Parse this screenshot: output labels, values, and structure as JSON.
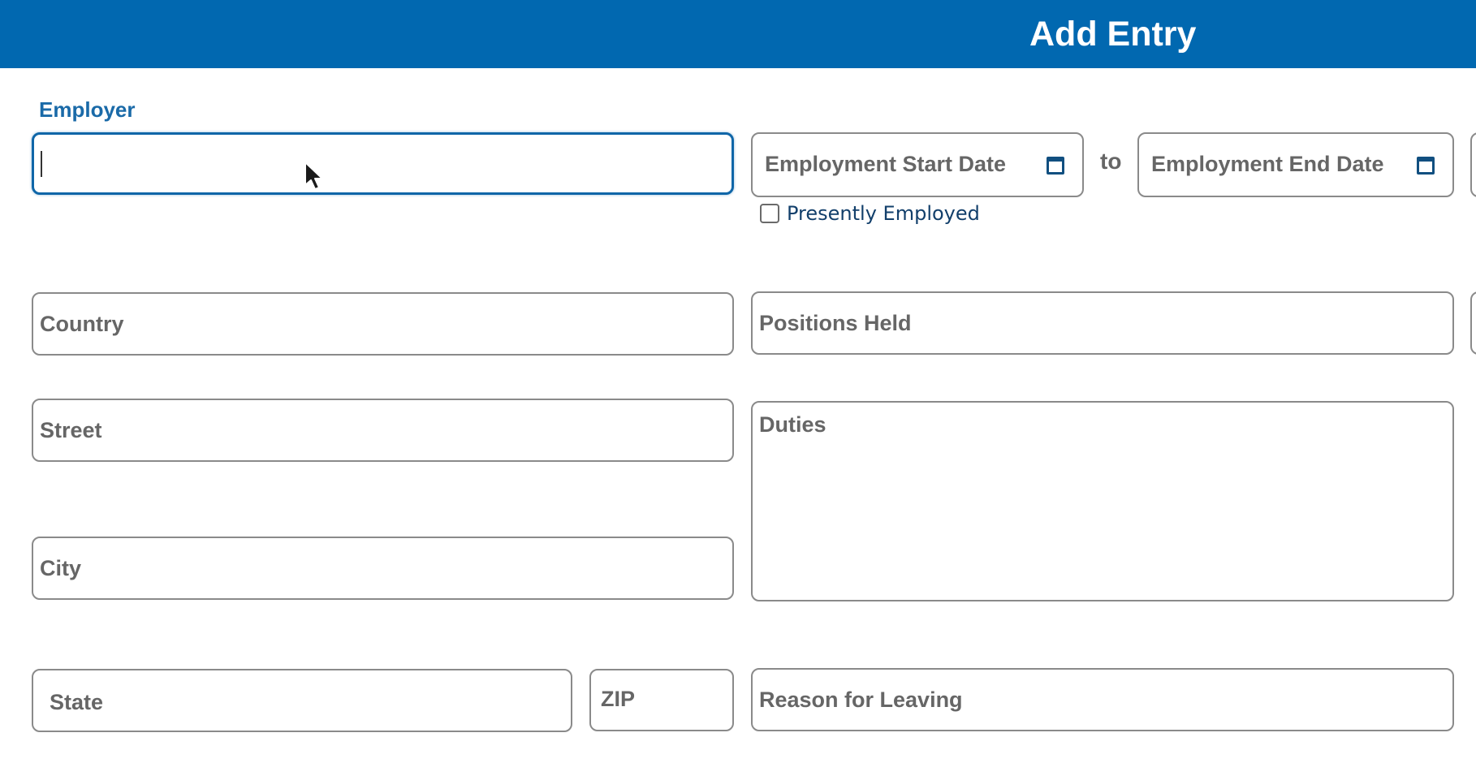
{
  "header": {
    "title": "Add Entry"
  },
  "form": {
    "employer": {
      "label": "Employer",
      "value": ""
    },
    "start_date": {
      "placeholder": "Employment Start Date",
      "icon": "calendar-icon"
    },
    "range_separator": "to",
    "end_date": {
      "placeholder": "Employment End Date",
      "icon": "calendar-icon"
    },
    "presently_employed": {
      "label": "Presently Employed",
      "checked": false
    },
    "country": {
      "placeholder": "Country"
    },
    "positions_held": {
      "placeholder": "Positions Held"
    },
    "street": {
      "placeholder": "Street"
    },
    "duties": {
      "placeholder": "Duties"
    },
    "city": {
      "placeholder": "City"
    },
    "state": {
      "placeholder": "State"
    },
    "zip": {
      "placeholder": "ZIP"
    },
    "reason_for_leaving": {
      "placeholder": "Reason for Leaving"
    }
  },
  "colors": {
    "header_bg": "#0168b0",
    "focus_border": "#0f66a8",
    "label_blue": "#1a6aa8"
  }
}
